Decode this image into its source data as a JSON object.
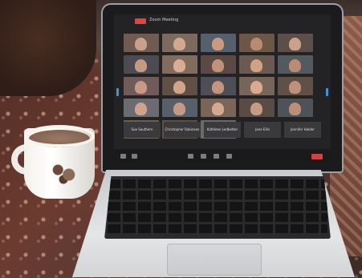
{
  "meeting": {
    "title": "Zoom Meeting",
    "clock": "",
    "live_label": ""
  },
  "participants_names": [
    "Sue Southern",
    "Christopher Robinson",
    "Kathleen Ledbetter",
    "Jane Ellis",
    "Jennifer Holder"
  ],
  "video_tiles": [
    {
      "bg": "#6f5b52",
      "face": "#c9a089"
    },
    {
      "bg": "#7d6a5f",
      "face": "#d2a98e"
    },
    {
      "bg": "#55606b",
      "face": "#c89b82"
    },
    {
      "bg": "#6b5647",
      "face": "#b98a72"
    },
    {
      "bg": "#5c4e48",
      "face": "#caa18a"
    },
    {
      "bg": "#4d4b52",
      "face": "#c49a84"
    },
    {
      "bg": "#826c5e",
      "face": "#d8ad94"
    },
    {
      "bg": "#5b4a44",
      "face": "#c0917b"
    },
    {
      "bg": "#6a5a4f",
      "face": "#cfa288"
    },
    {
      "bg": "#525a60",
      "face": "#b98c76"
    },
    {
      "bg": "#6e5b5a",
      "face": "#c79a85"
    },
    {
      "bg": "#5e5044",
      "face": "#d0a58c"
    },
    {
      "bg": "#4e4f56",
      "face": "#c29580"
    },
    {
      "bg": "#76665a",
      "face": "#d6ab90"
    },
    {
      "bg": "#615045",
      "face": "#bf917b"
    },
    {
      "bg": "#6c6a72",
      "face": "#cfa38b"
    },
    {
      "bg": "#57606a",
      "face": "#c49985"
    },
    {
      "bg": "#7a6558",
      "face": "#d4a98f"
    },
    {
      "bg": "#5a4b45",
      "face": "#c69a83"
    },
    {
      "bg": "#4e5358",
      "face": "#bb8e78"
    },
    {
      "bg": "#6d5e52",
      "face": "#cca088"
    },
    {
      "bg": "#5f4f49",
      "face": "#d1a68d"
    },
    {
      "bg": "#6a6a6a",
      "face": "#c79b84"
    }
  ],
  "colors": {
    "accent_blue": "#4a8fe0",
    "end_red": "#d0443d"
  },
  "icons": [
    "mute-icon",
    "video-icon",
    "share-icon",
    "participants-icon",
    "chat-icon",
    "record-icon"
  ]
}
